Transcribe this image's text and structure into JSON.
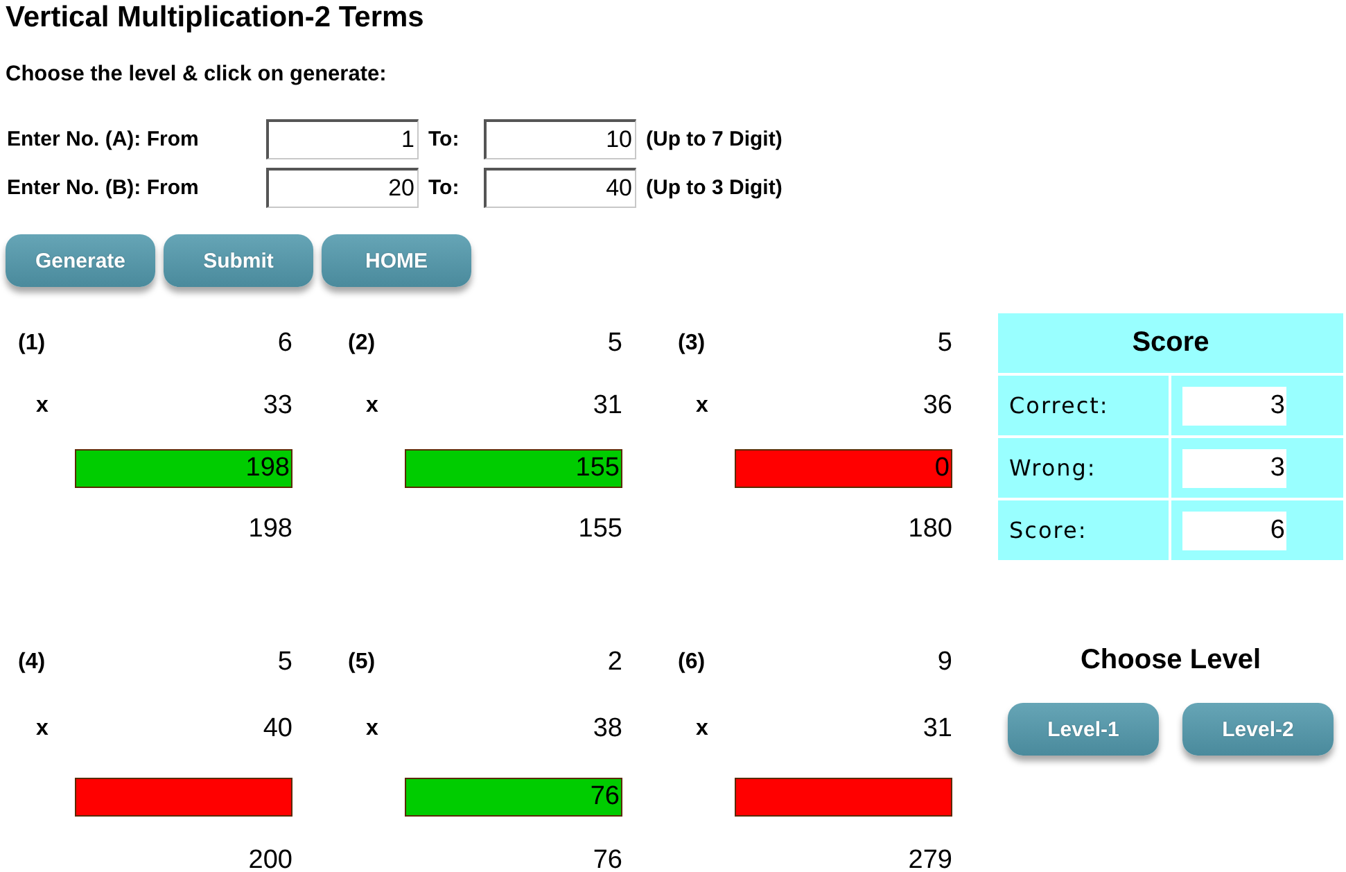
{
  "title": "Vertical Multiplication-2 Terms",
  "instruction": "Choose the level & click on generate:",
  "ranges": [
    {
      "label": "Enter No. (A): From",
      "from": "1",
      "to_label": "To:",
      "to": "10",
      "note": "(Up to 7 Digit)"
    },
    {
      "label": "Enter No. (B): From",
      "from": "20",
      "to_label": "To:",
      "to": "40",
      "note": "(Up to 3 Digit)"
    }
  ],
  "buttons": [
    "Generate",
    "Submit",
    "HOME"
  ],
  "problems": [
    {
      "number": "(1)",
      "first": "6",
      "operator": "x",
      "second": "33",
      "answer": "198",
      "correct": true,
      "solution": "198"
    },
    {
      "number": "(2)",
      "first": "5",
      "operator": "x",
      "second": "31",
      "answer": "155",
      "correct": true,
      "solution": "155"
    },
    {
      "number": "(3)",
      "first": "5",
      "operator": "x",
      "second": "36",
      "answer": "0",
      "correct": false,
      "solution": "180"
    },
    {
      "number": "(4)",
      "first": "5",
      "operator": "x",
      "second": "40",
      "correct": false,
      "solution": "200"
    },
    {
      "number": "(5)",
      "first": "2",
      "operator": "x",
      "second": "38",
      "answer": "76",
      "correct": true,
      "solution": "76"
    },
    {
      "number": "(6)",
      "first": "9",
      "operator": "x",
      "second": "31",
      "correct": false,
      "solution": "279"
    }
  ],
  "score": {
    "title": "Score",
    "rows": [
      {
        "label": "Correct:",
        "value": "3"
      },
      {
        "label": "Wrong:",
        "value": "3"
      },
      {
        "label": "Score:",
        "value": "6"
      }
    ]
  },
  "level_panel": {
    "title": "Choose Level",
    "buttons": [
      "Level-1",
      "Level-2"
    ]
  }
}
